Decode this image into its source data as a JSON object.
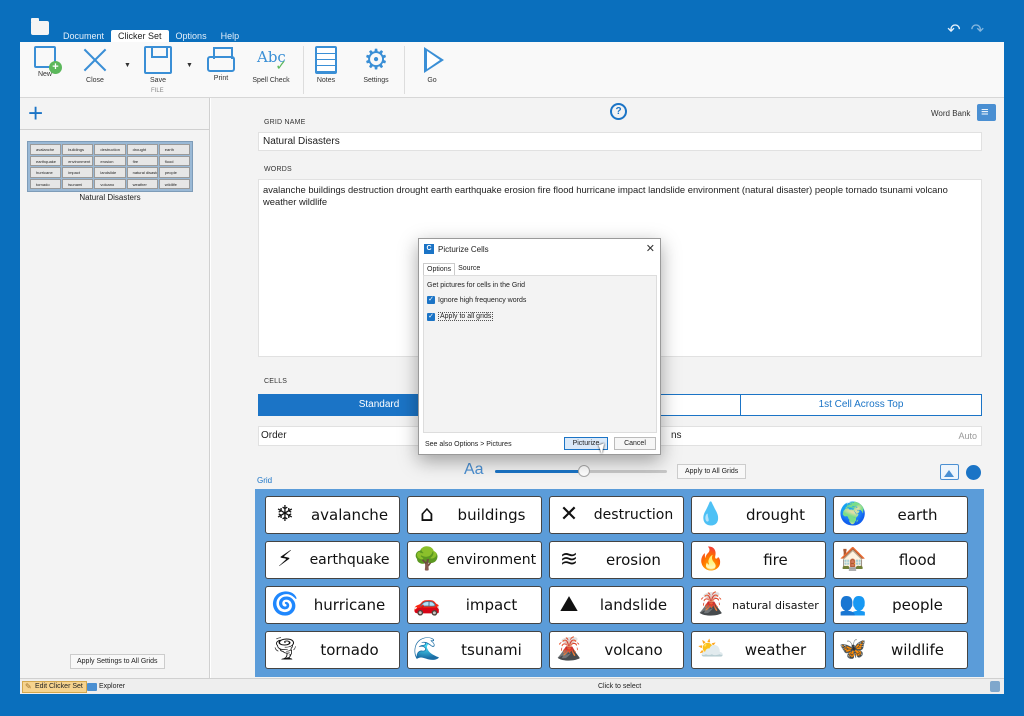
{
  "menu": {
    "tabs": [
      "Document",
      "Clicker Set",
      "Options",
      "Help"
    ],
    "active_tab": "Clicker Set"
  },
  "ribbon": {
    "new_label": "New",
    "close_label": "Close",
    "save_label": "Save",
    "print_label": "Print",
    "spell_label": "Spell Check",
    "file_group": "FILE",
    "notes_label": "Notes",
    "settings_label": "Settings",
    "go_label": "Go",
    "spell_icon_text": "Abc"
  },
  "left_panel": {
    "grid_thumb_label": "Natural Disasters",
    "thumb_cells": [
      "avalanche",
      "buildings",
      "destruction",
      "drought",
      "earth",
      "earthquake",
      "environment",
      "erosion",
      "fire",
      "flood",
      "hurricane",
      "impact",
      "landslide",
      "natural disaster",
      "people",
      "tornado",
      "tsunami",
      "volcano",
      "weather",
      "wildlife"
    ],
    "apply_settings_label": "Apply Settings to All Grids"
  },
  "main": {
    "word_bank_label": "Word Bank",
    "grid_name_label": "GRID NAME",
    "grid_name_value": "Natural Disasters",
    "words_label": "WORDS",
    "words_value": "avalanche buildings destruction drought earth earthquake erosion fire flood hurricane impact landslide environment (natural disaster) people tornado tsunami volcano weather wildlife",
    "cells_label": "CELLS",
    "cells_tabs": [
      "Standard",
      "",
      "1st Cell Across Top"
    ],
    "cells_active": "Standard",
    "order_label": "Order",
    "order_suffix": "ns",
    "order_value": "Auto",
    "grid_label": "Grid",
    "text_size_label": "Aa",
    "text_size_level": 0.52,
    "apply_all_grids_label": "Apply to All Grids",
    "accent_color": "#1b74c6",
    "grid_background_color": "#5b9cd9"
  },
  "grid_cells": [
    {
      "label": "avalanche",
      "icon": "❄"
    },
    {
      "label": "buildings",
      "icon": "⌂"
    },
    {
      "label": "destruction",
      "icon": "✕"
    },
    {
      "label": "drought",
      "icon": "💧"
    },
    {
      "label": "earth",
      "icon": "🌍"
    },
    {
      "label": "earthquake",
      "icon": "⚡"
    },
    {
      "label": "environment",
      "icon": "🌳"
    },
    {
      "label": "erosion",
      "icon": "≋"
    },
    {
      "label": "fire",
      "icon": "🔥"
    },
    {
      "label": "flood",
      "icon": "🏠"
    },
    {
      "label": "hurricane",
      "icon": "🌀"
    },
    {
      "label": "impact",
      "icon": "🚗"
    },
    {
      "label": "landslide",
      "icon": "⛰"
    },
    {
      "label": "natural disaster",
      "icon": "🌋"
    },
    {
      "label": "people",
      "icon": "👥"
    },
    {
      "label": "tornado",
      "icon": "🌪"
    },
    {
      "label": "tsunami",
      "icon": "🌊"
    },
    {
      "label": "volcano",
      "icon": "🌋"
    },
    {
      "label": "weather",
      "icon": "⛅"
    },
    {
      "label": "wildlife",
      "icon": "🦋"
    }
  ],
  "dialog": {
    "app_icon_letter": "C",
    "title": "Picturize Cells",
    "tabs": [
      "Options",
      "Source"
    ],
    "active_tab": "Options",
    "intro": "Get pictures for cells in the Grid",
    "check_ignore": "Ignore high frequency words",
    "check_apply": "Apply to all grids",
    "ignore_checked": true,
    "apply_checked": true,
    "footer_text": "See also Options > Pictures",
    "picturize_label": "Picturize",
    "cancel_label": "Cancel"
  },
  "status": {
    "edit_label": "Edit Clicker Set",
    "explorer_label": "Explorer",
    "center_text": "Click to select"
  }
}
